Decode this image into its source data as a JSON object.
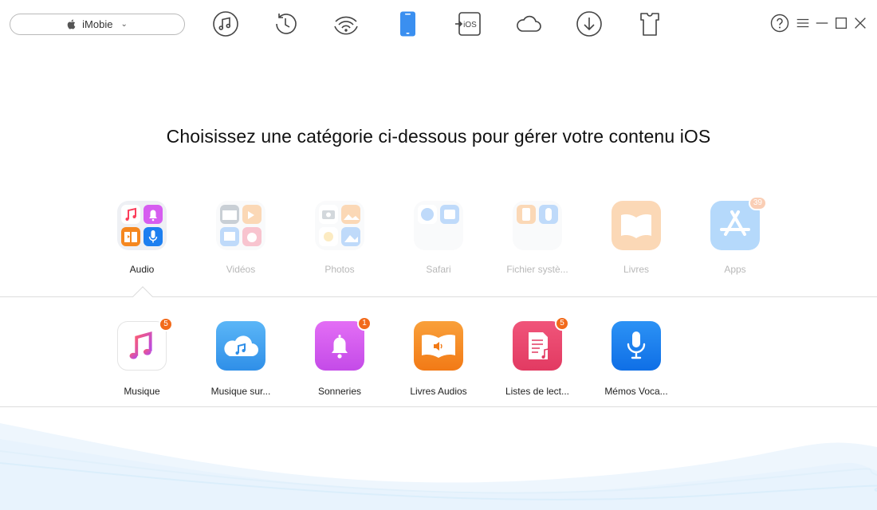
{
  "device": {
    "name": "iMobie"
  },
  "toolbar": {
    "items": [
      {
        "icon": "music-note-icon"
      },
      {
        "icon": "history-icon"
      },
      {
        "icon": "wifi-icon"
      },
      {
        "icon": "phone-icon",
        "active": true
      },
      {
        "icon": "ios-transfer-icon",
        "text": "iOS"
      },
      {
        "icon": "cloud-icon"
      },
      {
        "icon": "download-icon"
      },
      {
        "icon": "tshirt-icon"
      }
    ]
  },
  "headline": "Choisissez une catégorie ci-dessous pour gérer votre contenu iOS",
  "categories": [
    {
      "label": "Audio",
      "active": true
    },
    {
      "label": "Vidéos"
    },
    {
      "label": "Photos"
    },
    {
      "label": "Safari"
    },
    {
      "label": "Fichier systè..."
    },
    {
      "label": "Livres"
    },
    {
      "label": "Apps",
      "badge": "39"
    }
  ],
  "subitems": [
    {
      "label": "Musique",
      "badge": "5"
    },
    {
      "label": "Musique sur..."
    },
    {
      "label": "Sonneries",
      "badge": "1"
    },
    {
      "label": "Livres Audios"
    },
    {
      "label": "Listes de lect...",
      "badge": "5"
    },
    {
      "label": "Mémos Voca..."
    }
  ],
  "colors": {
    "accent": "#3a8ff0",
    "badge": "#f26a1b",
    "music_pink": "#fb3f5c",
    "cloud_blue": "#4aa8f3",
    "bell_purple": "#d65df0",
    "audiobook_orange": "#f5871f",
    "playlist_red": "#ec4a6e",
    "voice_blue": "#1d7ff0"
  }
}
